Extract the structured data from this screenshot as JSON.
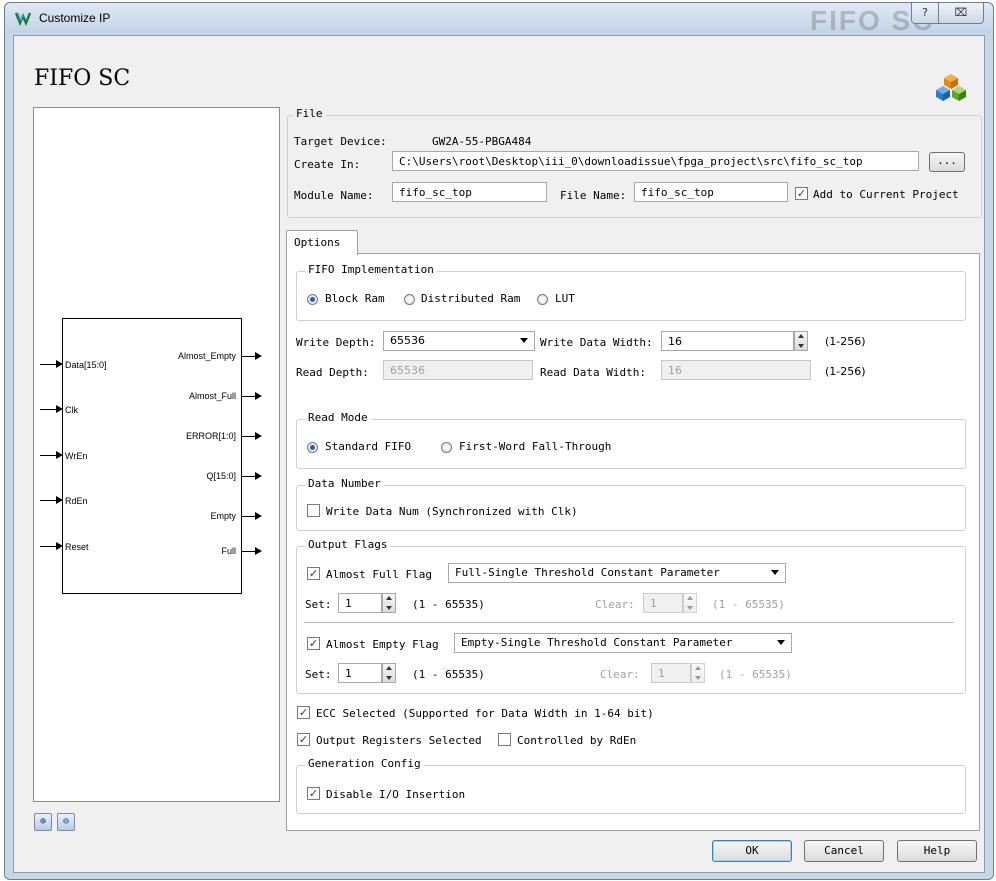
{
  "window": {
    "title": "Customize IP",
    "watermark": "FIFO SC",
    "help_btn": "?",
    "close_btn": "⌧"
  },
  "header": {
    "title": "FIFO SC"
  },
  "schematic": {
    "left_pins": [
      "Data[15:0]",
      "Clk",
      "WrEn",
      "RdEn",
      "Reset"
    ],
    "right_pins": [
      "Almost_Empty",
      "Almost_Full",
      "ERROR[1:0]",
      "Q[15:0]",
      "Empty",
      "Full"
    ]
  },
  "file": {
    "legend": "File",
    "target_device_label": "Target Device:",
    "target_device": "GW2A-55-PBGA484",
    "create_in_label": "Create In:",
    "create_in": "C:\\Users\\root\\Desktop\\iii_0\\downloadissue\\fpga_project\\src\\fifo_sc_top",
    "browse": "...",
    "module_name_label": "Module Name:",
    "module_name": "fifo_sc_top",
    "file_name_label": "File Name:",
    "file_name": "fifo_sc_top",
    "add_to_project": "Add to Current Project"
  },
  "options": {
    "tab": "Options",
    "fifo_impl": {
      "legend": "FIFO Implementation",
      "block_ram": "Block Ram",
      "distributed_ram": "Distributed Ram",
      "lut": "LUT"
    },
    "write_depth_label": "Write Depth:",
    "write_depth": "65536",
    "write_width_label": "Write Data Width:",
    "write_width": "16",
    "write_range": "(1-256)",
    "read_depth_label": "Read Depth:",
    "read_depth": "65536",
    "read_width_label": "Read Data Width:",
    "read_width": "16",
    "read_range": "(1-256)",
    "read_mode": {
      "legend": "Read Mode",
      "standard": "Standard FIFO",
      "fwft": "First-Word Fall-Through"
    },
    "data_number": {
      "legend": "Data Number",
      "write_num": "Write Data Num (Synchronized with Clk)"
    },
    "output_flags": {
      "legend": "Output Flags",
      "almost_full": "Almost Full Flag",
      "almost_full_mode": "Full-Single Threshold Constant Parameter",
      "af_set_label": "Set:",
      "af_set": "1",
      "af_set_range": "(1 - 65535)",
      "af_clear_label": "Clear:",
      "af_clear": "1",
      "af_clear_range": "(1 - 65535)",
      "almost_empty": "Almost Empty Flag",
      "almost_empty_mode": "Empty-Single Threshold Constant Parameter",
      "ae_set_label": "Set:",
      "ae_set": "1",
      "ae_set_range": "(1 - 65535)",
      "ae_clear_label": "Clear:",
      "ae_clear": "1",
      "ae_clear_range": "(1 - 65535)"
    },
    "ecc": "ECC Selected (Supported for Data Width in 1-64 bit)",
    "output_reg": "Output Registers Selected",
    "controlled_rden": "Controlled by RdEn",
    "gen_config": {
      "legend": "Generation Config",
      "disable_io": "Disable I/O Insertion"
    }
  },
  "buttons": {
    "ok": "OK",
    "cancel": "Cancel",
    "help": "Help"
  }
}
